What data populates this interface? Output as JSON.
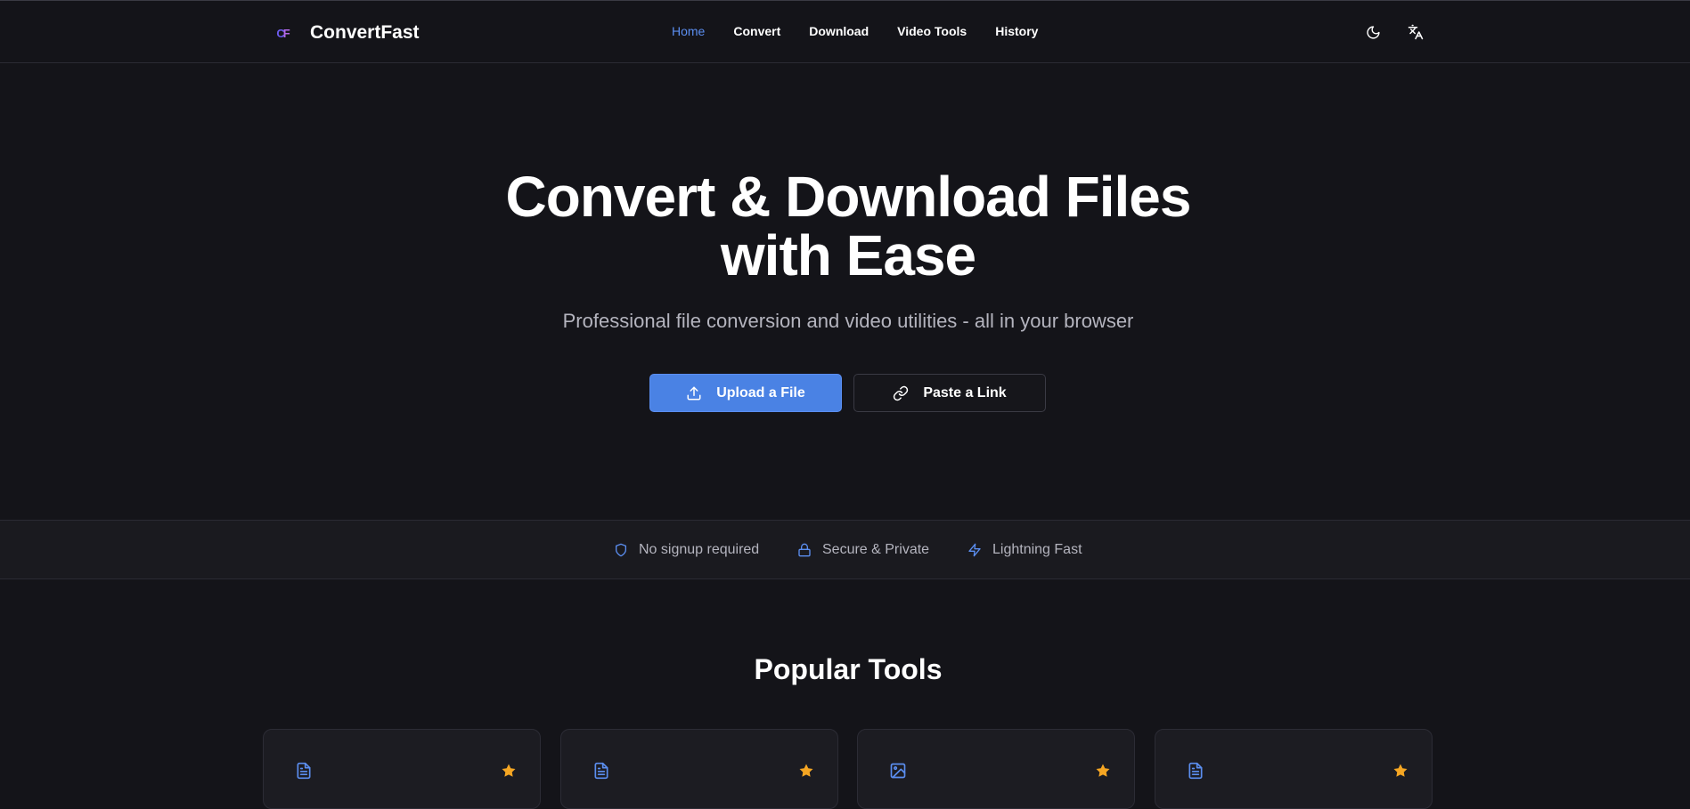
{
  "header": {
    "brand": "ConvertFast",
    "logo_letters": {
      "c": "C",
      "f": "F"
    },
    "nav": [
      {
        "label": "Home",
        "active": true
      },
      {
        "label": "Convert",
        "active": false
      },
      {
        "label": "Download",
        "active": false
      },
      {
        "label": "Video Tools",
        "active": false
      },
      {
        "label": "History",
        "active": false
      }
    ],
    "icons": [
      "moon-icon",
      "translate-icon"
    ]
  },
  "hero": {
    "title_line1": "Convert & Download Files",
    "title_line2": "with Ease",
    "subtitle": "Professional file conversion and video utilities - all in your browser",
    "upload_label": "Upload a File",
    "link_label": "Paste a Link"
  },
  "features": [
    {
      "label": "No signup required",
      "icon": "shield-icon"
    },
    {
      "label": "Secure & Private",
      "icon": "lock-icon"
    },
    {
      "label": "Lightning Fast",
      "icon": "lightning-icon"
    }
  ],
  "tools": {
    "title": "Popular Tools",
    "cards": [
      {
        "icon": "document-icon"
      },
      {
        "icon": "document-icon"
      },
      {
        "icon": "image-icon"
      },
      {
        "icon": "document-icon"
      }
    ]
  },
  "colors": {
    "background": "#141419",
    "accent": "#4a82e4",
    "nav_active": "#5b8ef0",
    "star": "#f5a623",
    "muted_text": "#b4b4be"
  }
}
